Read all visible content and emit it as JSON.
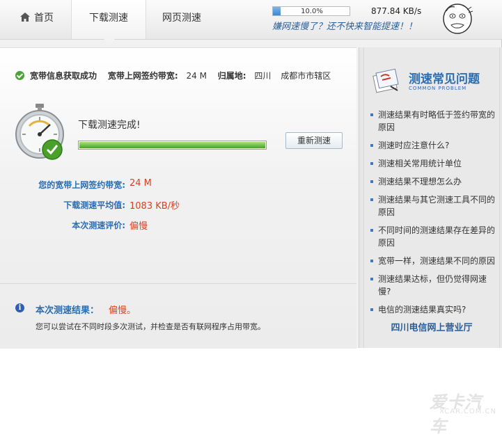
{
  "nav": {
    "home_label": "首页",
    "download_label": "下载测速",
    "web_label": "网页测速"
  },
  "speed": {
    "progress": 0.1,
    "percent_text": "10.0%",
    "rate": "877.84 KB/s",
    "slogan": "嫌网速慢了？还不快来智能提速！！"
  },
  "status": {
    "info_label": "宽带信息获取成功",
    "bandwidth_label": "宽带上网签约带宽:",
    "bandwidth_value": "24 M",
    "location_label": "归属地:",
    "location_province": "四川",
    "location_city": "成都市市辖区"
  },
  "test": {
    "complete_text": "下载测速完成!",
    "progress": 1.0,
    "retest_label": "重新测速"
  },
  "results": [
    {
      "label": "您的宽带上网签约带宽:",
      "value": "24 M"
    },
    {
      "label": "下载测速平均值:",
      "value": "1083 KB/秒"
    },
    {
      "label": "本次测速评价:",
      "value": "偏慢"
    }
  ],
  "summary": {
    "label": "本次测速结果：",
    "value": "偏慢。",
    "tip": "您可以尝试在不同时段多次测试，并检查是否有联网程序占用带宽。"
  },
  "sidebar": {
    "title": "测速常见问题",
    "subtitle": "COMMON PROBLEM",
    "items": [
      "测速结果有时略低于签约带宽的原因",
      "测速时应注意什么?",
      "测速相关常用统计单位",
      "测速结果不理想怎么办",
      "测速结果与其它测速工具不同的原因",
      "不同时间的测速结果存在差异的原因",
      "宽带一样，测速结果不同的原因",
      "测速结果达标，但仍觉得网速慢?",
      "电信的测速结果真实吗?"
    ],
    "footer_link": "四川电信网上营业厅"
  },
  "watermark": {
    "big": "爱卡汽车",
    "small": "XCAR.COM.CN"
  },
  "colors": {
    "accent_blue": "#2a6db1",
    "result_red": "#d9411c",
    "progress_green": "#4aa02a"
  }
}
